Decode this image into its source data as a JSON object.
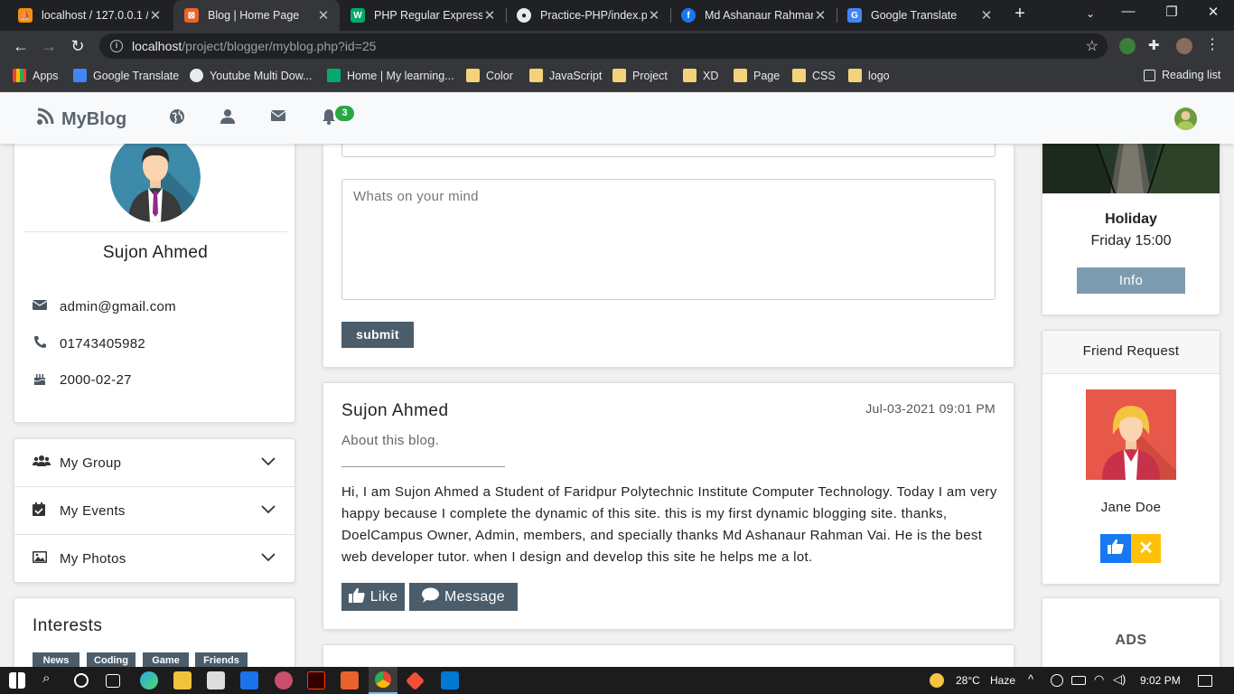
{
  "browser": {
    "tabs": [
      {
        "title": "localhost / 127.0.0.1 / l",
        "active": false
      },
      {
        "title": "Blog | Home Page",
        "active": true
      },
      {
        "title": "PHP Regular Expressio",
        "active": false
      },
      {
        "title": "Practice-PHP/index.ph",
        "active": false
      },
      {
        "title": "Md Ashanaur Rahman",
        "active": false
      },
      {
        "title": "Google Translate",
        "active": false
      }
    ],
    "url_host": "localhost",
    "url_path": "/project/blogger/myblog.php?id=25",
    "bookmarks": {
      "apps": "Apps",
      "google_translate": "Google Translate",
      "youtube": "Youtube Multi Dow...",
      "home": "Home | My learning...",
      "folders": [
        "Color",
        "JavaScript",
        "Project",
        "XD",
        "Page",
        "CSS",
        "logo"
      ],
      "reading_list": "Reading list"
    }
  },
  "site": {
    "brand": "MyBlog",
    "notification_count": "3"
  },
  "profile": {
    "name": "Sujon Ahmed",
    "email": "admin@gmail.com",
    "phone": "01743405982",
    "birthday": "2000-02-27"
  },
  "accordion": {
    "group": "My Group",
    "events": "My Events",
    "photos": "My Photos"
  },
  "interests": {
    "title": "Interests",
    "tags": [
      "News",
      "Coding",
      "Game",
      "Friends"
    ]
  },
  "composer": {
    "placeholder": "Whats on your mind",
    "submit": "submit"
  },
  "post": {
    "author": "Sujon Ahmed",
    "date": "Jul-03-2021 09:01 PM",
    "subtitle": "About this blog.",
    "body": "Hi, I am Sujon Ahmed a Student of Faridpur Polytechnic Institute Computer Technology. Today I am very happy because I complete the dynamic of this site. this is my first dynamic blogging site. thanks, DoelCampus Owner, Admin, members, and specially thanks Md Ashanaur Rahman Vai. He is the best web developer tutor. when I design and develop this site he helps me a lot.",
    "like": "Like",
    "message": "Message"
  },
  "event": {
    "title": "Holiday",
    "time": "Friday 15:00",
    "info_button": "Info"
  },
  "friend_request": {
    "heading": "Friend Request",
    "name": "Jane Doe"
  },
  "ads": {
    "label": "ADS"
  },
  "taskbar": {
    "temperature": "28°C",
    "weather": "Haze",
    "time": "9:02 PM"
  },
  "colors": {
    "primary_button": "#4b5d6b",
    "info_button": "#7d9bb0",
    "accept": "#1877f2",
    "decline": "#ffc107",
    "badge": "#28a745"
  }
}
